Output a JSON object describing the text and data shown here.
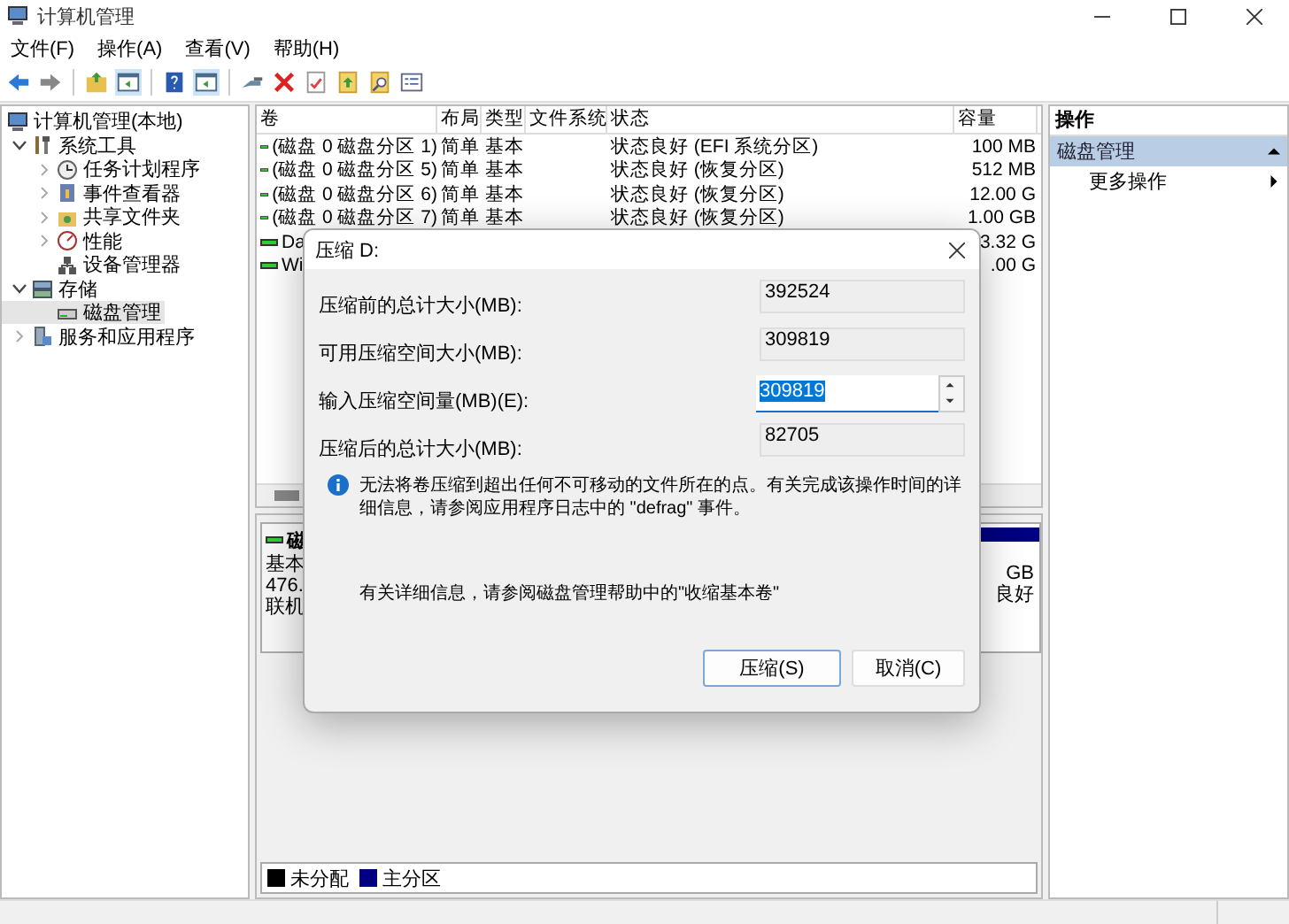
{
  "window": {
    "title": "计算机管理"
  },
  "menu": [
    "文件(F)",
    "操作(A)",
    "查看(V)",
    "帮助(H)"
  ],
  "toolbar": [
    {
      "kind": "back",
      "on": false
    },
    {
      "kind": "forward",
      "on": false
    },
    {
      "kind": "folder-up",
      "on": false
    },
    {
      "kind": "pane",
      "on": true
    },
    {
      "kind": "help",
      "on": false
    },
    {
      "kind": "pane",
      "on": true
    },
    {
      "kind": "connect",
      "on": false
    },
    {
      "kind": "delete",
      "on": false
    },
    {
      "kind": "check",
      "on": false
    },
    {
      "kind": "export",
      "on": false
    },
    {
      "kind": "search",
      "on": false
    },
    {
      "kind": "properties",
      "on": false
    }
  ],
  "tree": [
    {
      "label": "计算机管理(本地)",
      "kind": "root",
      "selected": false,
      "children": [
        {
          "label": "系统工具",
          "kind": "node",
          "expanded": true,
          "selected": false,
          "children": [
            {
              "label": "任务计划程序",
              "kind": "node",
              "expanded": false,
              "selected": false
            },
            {
              "label": "事件查看器",
              "kind": "node",
              "expanded": false,
              "selected": false
            },
            {
              "label": "共享文件夹",
              "kind": "node",
              "expanded": false,
              "selected": false
            },
            {
              "label": "性能",
              "kind": "node",
              "expanded": false,
              "selected": false
            },
            {
              "label": "设备管理器",
              "kind": "leaf",
              "selected": false
            }
          ]
        },
        {
          "label": "存储",
          "kind": "node",
          "expanded": true,
          "selected": false,
          "children": [
            {
              "label": "磁盘管理",
              "kind": "leaf",
              "selected": true
            }
          ]
        },
        {
          "label": "服务和应用程序",
          "kind": "node",
          "expanded": false,
          "selected": false
        }
      ]
    }
  ],
  "table": {
    "columns": [
      "卷",
      "布局",
      "类型",
      "文件系统",
      "状态",
      "容量"
    ],
    "rows": [
      {
        "volume": "(磁盘 0 磁盘分区 1)",
        "layout": "简单",
        "type": "基本",
        "status": "状态良好 (EFI 系统分区)",
        "capacity": "100 MB"
      },
      {
        "volume": "(磁盘 0 磁盘分区 5)",
        "layout": "简单",
        "type": "基本",
        "status": "状态良好 (恢复分区)",
        "capacity": "512 MB"
      },
      {
        "volume": "(磁盘 0 磁盘分区 6)",
        "layout": "简单",
        "type": "基本",
        "status": "状态良好 (恢复分区)",
        "capacity": "12.00 G"
      },
      {
        "volume": "(磁盘 0 磁盘分区 7)",
        "layout": "简单",
        "type": "基本",
        "status": "状态良好 (恢复分区)",
        "capacity": "1.00 GB"
      },
      {
        "volume": "Da",
        "capacity": "3.32 G"
      },
      {
        "volume": "Wi",
        "capacity": ".00 G"
      }
    ]
  },
  "disk": {
    "name": "磁",
    "lines": [
      "基本",
      "476.",
      "联机"
    ],
    "partition_lines": [
      "GB",
      "良好"
    ]
  },
  "legend": [
    {
      "label": "未分配",
      "color": "#000000"
    },
    {
      "label": "主分区",
      "color": "#000080"
    }
  ],
  "actions": {
    "header": "操作",
    "section": {
      "label": "磁盘管理",
      "expanded": true,
      "selected": true
    },
    "items": [
      "更多操作"
    ]
  },
  "dialog": {
    "title": "压缩 D:",
    "fields": [
      {
        "label": "压缩前的总计大小(MB):",
        "value": "392524",
        "kind": "readonly",
        "text_selected": false
      },
      {
        "label": "可用压缩空间大小(MB):",
        "value": "309819",
        "kind": "readonly",
        "text_selected": false
      },
      {
        "label": "输入压缩空间量(MB)(E):",
        "value": "309819",
        "kind": "spin",
        "text_selected": true
      },
      {
        "label": "压缩后的总计大小(MB):",
        "value": "82705",
        "kind": "readonly",
        "text_selected": false
      }
    ],
    "info": "无法将卷压缩到超出任何不可移动的文件所在的点。有关完成该操作时间的详细信息，请参阅应用程序日志中的 \"defrag\" 事件。",
    "help": "有关详细信息，请参阅磁盘管理帮助中的\"收缩基本卷\"",
    "buttons": [
      {
        "label": "压缩(S)",
        "default": true
      },
      {
        "label": "取消(C)",
        "default": false
      }
    ]
  }
}
